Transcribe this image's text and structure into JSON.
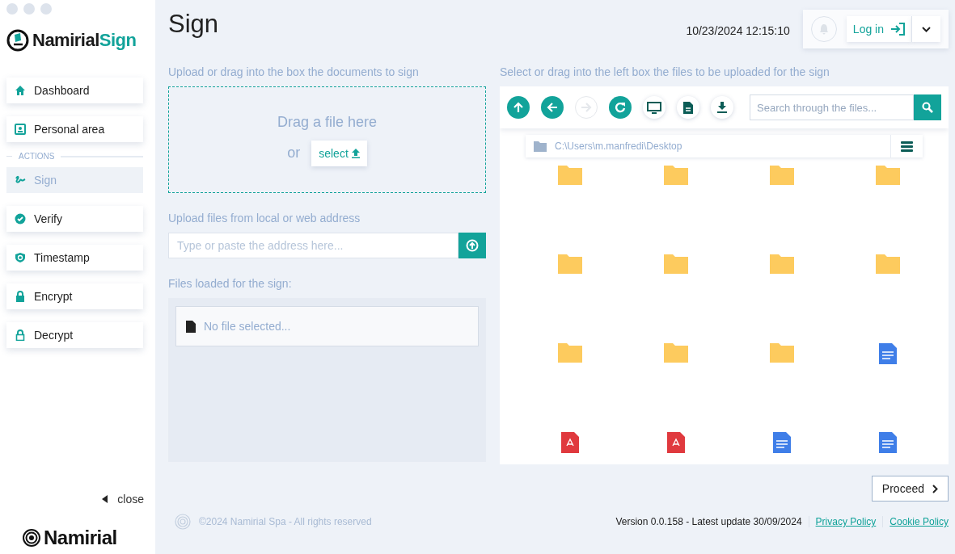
{
  "sidebar": {
    "logo": {
      "name": "Namirial",
      "accent": "Sign"
    },
    "items": [
      {
        "label": "Dashboard",
        "selected": false
      },
      {
        "label": "Personal area",
        "selected": false
      }
    ],
    "section": "ACTIONS",
    "actions": [
      {
        "label": "Sign",
        "selected": true
      },
      {
        "label": "Verify",
        "selected": false
      },
      {
        "label": "Timestamp",
        "selected": false
      },
      {
        "label": "Encrypt",
        "selected": false
      },
      {
        "label": "Decrypt",
        "selected": false
      }
    ],
    "close": "close",
    "brand": "Namirial"
  },
  "header": {
    "title": "Sign",
    "datetime": "10/23/2024 12:15:10",
    "login": "Log in"
  },
  "upload": {
    "label": "Upload or drag into the box the documents to sign",
    "drop_text": "Drag a file here",
    "or": "or",
    "select": "select",
    "address_label": "Upload files from local or web address",
    "address_placeholder": "Type or paste the address here...",
    "loaded_label": "Files loaded for the sign:",
    "empty": "No file selected..."
  },
  "browser": {
    "label": "Select or drag into the left box the files to be uploaded for the sign",
    "tools": [
      {
        "kind": "filled",
        "disabled": false
      },
      {
        "kind": "filled",
        "disabled": false
      },
      {
        "kind": "filled",
        "disabled": true
      },
      {
        "kind": "filled",
        "disabled": false
      },
      {
        "kind": "plain",
        "disabled": false
      },
      {
        "kind": "plain",
        "disabled": false
      },
      {
        "kind": "plain",
        "disabled": false
      }
    ],
    "search_placeholder": "Search through the files...",
    "path": "C:\\Users\\m.manfredi\\Desktop",
    "files": [
      {
        "kind": "folder"
      },
      {
        "kind": "folder"
      },
      {
        "kind": "folder"
      },
      {
        "kind": "folder"
      },
      {
        "kind": "folder"
      },
      {
        "kind": "folder"
      },
      {
        "kind": "folder"
      },
      {
        "kind": "folder"
      },
      {
        "kind": "folder"
      },
      {
        "kind": "folder"
      },
      {
        "kind": "folder"
      },
      {
        "kind": "doc"
      },
      {
        "kind": "pdf"
      },
      {
        "kind": "pdf"
      },
      {
        "kind": "doc"
      },
      {
        "kind": "doc"
      }
    ]
  },
  "proceed": "Proceed",
  "footer": {
    "copyright": "©2024 Namirial Spa - All rights reserved",
    "version": "Version 0.0.158 - Latest update 30/09/2024",
    "links": [
      "Privacy Policy",
      "Cookie Policy"
    ]
  }
}
